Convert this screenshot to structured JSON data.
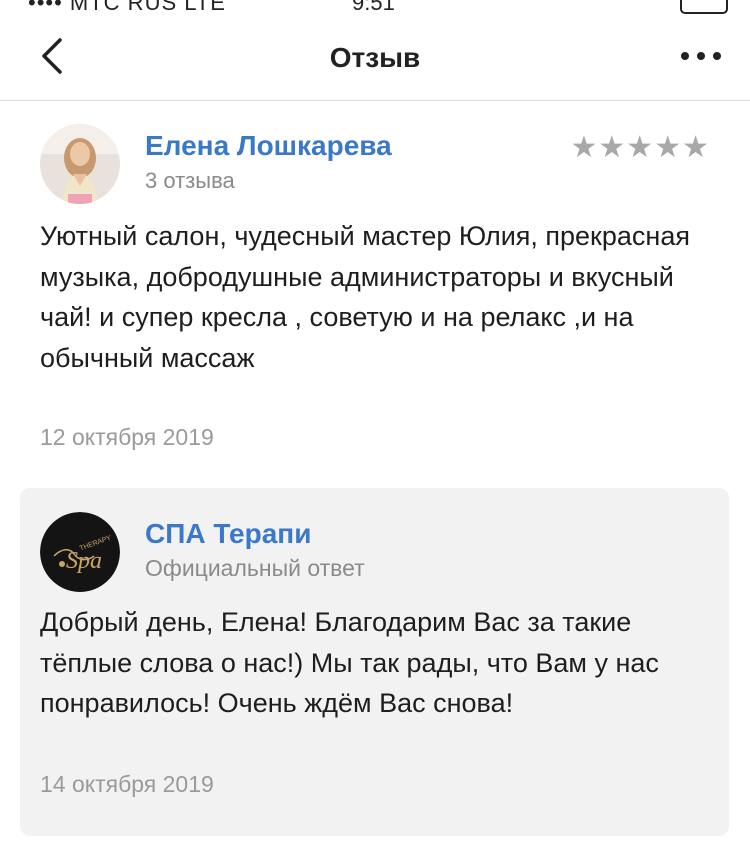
{
  "header": {
    "title": "Отзыв",
    "back_icon": "chevron-left-icon",
    "more_icon": "more-horizontal-icon"
  },
  "review": {
    "author_name": "Елена Лошкарева",
    "author_meta": "3 отзыва",
    "rating": 5,
    "rating_max": 5,
    "stars": "★★★★★",
    "text": "Уютный салон, чудесный мастер Юлия, прекрасная музыка, добродушные администраторы и вкусный чай! и супер кресла , советую и на релакс ,и на обычный массаж",
    "date": "12 октября 2019"
  },
  "reply": {
    "author_name": "СПА Терапи",
    "author_meta": "Официальный ответ",
    "logo_text_small": "THERAPY",
    "logo_text_large": "Spa",
    "text": "Добрый день, Елена! Благодарим Вас за такие тёплые слова о нас!) Мы так рады, что Вам у нас понравилось! Очень ждём Вас снова!",
    "date": "14 октября 2019"
  },
  "colors": {
    "link": "#3a78c8",
    "muted": "#8a8a8a",
    "star": "#a8a8a8",
    "reply_bg": "#f2f2f2",
    "divider": "#d9d9d9"
  }
}
